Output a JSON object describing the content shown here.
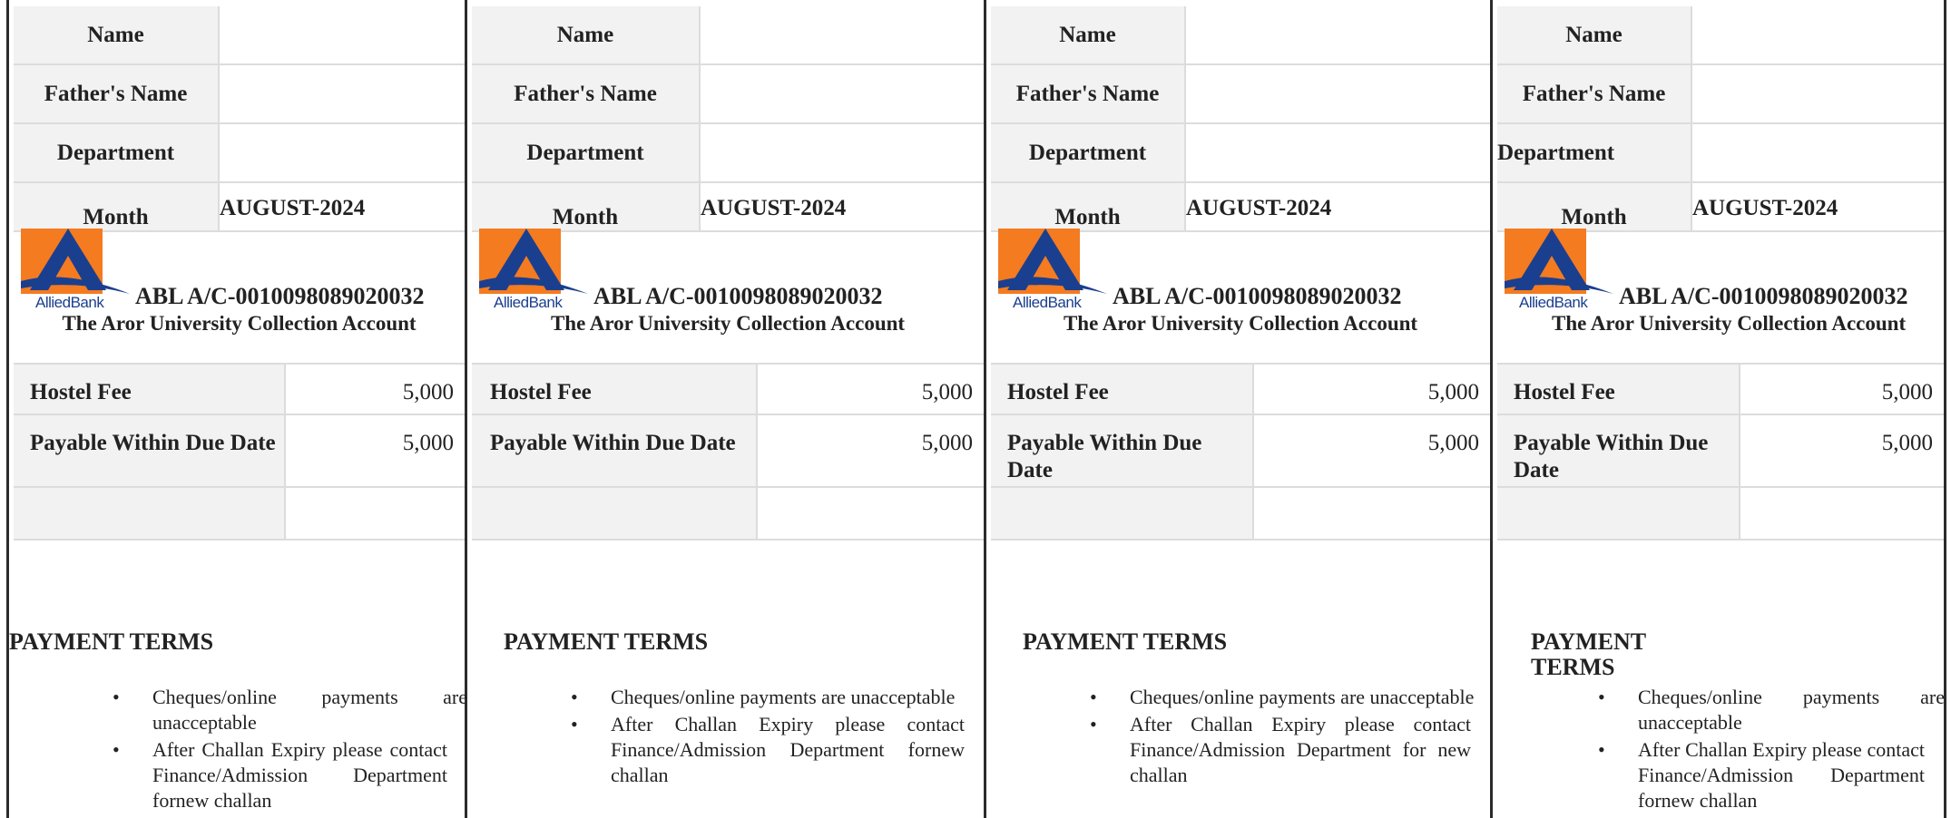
{
  "challans": [
    {
      "labels": {
        "name": "Name",
        "father": "Father's Name",
        "department": "Department",
        "month": "Month"
      },
      "month_value": "AUGUST-2024",
      "bank": {
        "logo_text": "AlliedBank",
        "account": "ABL A/C-0010098089020032",
        "account_name": "The Aror University Collection Account"
      },
      "fees": [
        {
          "label": "Hostel Fee",
          "value": "5,000"
        },
        {
          "label": "Payable Within Due Date",
          "value": "5,000"
        }
      ],
      "terms_heading": "PAYMENT TERMS",
      "terms": [
        "Cheques/online payments are unacceptable",
        "After Challan Expiry please contact Finance/Admission Department fornew challan"
      ]
    },
    {
      "labels": {
        "name": "Name",
        "father": "Father's Name",
        "department": "Department",
        "month": "Month"
      },
      "month_value": "AUGUST-2024",
      "bank": {
        "logo_text": "AlliedBank",
        "account": "ABL A/C-0010098089020032",
        "account_name": "The Aror University Collection Account"
      },
      "fees": [
        {
          "label": "Hostel Fee",
          "value": "5,000"
        },
        {
          "label": "Payable Within Due Date",
          "value": "5,000"
        }
      ],
      "terms_heading": "PAYMENT TERMS",
      "terms": [
        "Cheques/online payments are unacceptable",
        "After Challan Expiry please contact Finance/Admission Department fornew challan"
      ]
    },
    {
      "labels": {
        "name": "Name",
        "father": "Father's Name",
        "department": "Department",
        "month": "Month"
      },
      "month_value": "AUGUST-2024",
      "bank": {
        "logo_text": "AlliedBank",
        "account": "ABL A/C-0010098089020032",
        "account_name": "The Aror University Collection Account"
      },
      "fees": [
        {
          "label": "Hostel Fee",
          "value": "5,000"
        },
        {
          "label": "Payable Within Due Date",
          "value": "5,000"
        }
      ],
      "terms_heading": "PAYMENT TERMS",
      "terms": [
        "Cheques/online payments are unacceptable",
        "After Challan Expiry please contact Finance/Admission Department for new challan"
      ]
    },
    {
      "labels": {
        "name": "Name",
        "father": "Father's Name",
        "department": "Department",
        "month": "Month"
      },
      "month_value": "AUGUST-2024",
      "bank": {
        "logo_text": "AlliedBank",
        "account": "ABL A/C-0010098089020032",
        "account_name": "The Aror University Collection Account"
      },
      "fees": [
        {
          "label": "Hostel Fee",
          "value": "5,000"
        },
        {
          "label": "Payable Within Due Date",
          "value": "5,000"
        }
      ],
      "terms_heading": "PAYMENT TERMS",
      "terms": [
        "Cheques/online payments are unacceptable",
        "After Challan Expiry please contact Finance/Admission Department fornew challan"
      ]
    }
  ],
  "colors": {
    "logo_orange": "#f47b20",
    "logo_blue": "#1b3f8f",
    "label_bg": "#f2f2f2"
  }
}
